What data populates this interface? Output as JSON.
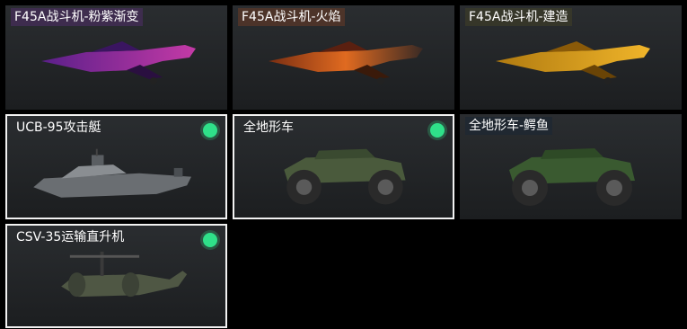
{
  "items": [
    {
      "label": "F45A战斗机-粉紫渐变",
      "icon": "jet-icon",
      "selected": false,
      "unlocked": false,
      "colors": [
        "#5a1f8a",
        "#c43aa6"
      ]
    },
    {
      "label": "F45A战斗机-火焰",
      "icon": "jet-icon",
      "selected": false,
      "unlocked": false,
      "colors": [
        "#7a2e12",
        "#e06a20"
      ]
    },
    {
      "label": "F45A战斗机-建造",
      "icon": "jet-icon",
      "selected": false,
      "unlocked": false,
      "colors": [
        "#b07a10",
        "#f0b52a"
      ]
    },
    {
      "label": "UCB-95攻击艇",
      "icon": "boat-icon",
      "selected": true,
      "unlocked": true,
      "colors": [
        "#6a6e72",
        "#a9adb0"
      ]
    },
    {
      "label": "全地形车",
      "icon": "atv-icon",
      "selected": true,
      "unlocked": true,
      "colors": [
        "#4a5a3c",
        "#7a8a66"
      ]
    },
    {
      "label": "全地形车-鳄鱼",
      "icon": "atv-icon",
      "selected": false,
      "unlocked": false,
      "colors": [
        "#3a5a30",
        "#6a8a4a"
      ]
    },
    {
      "label": "CSV-35运输直升机",
      "icon": "helicopter-icon",
      "selected": true,
      "unlocked": true,
      "colors": [
        "#4f5744",
        "#8a9176"
      ]
    }
  ],
  "colors": {
    "unlocked_dot": "#2fe089",
    "selected_border": "#f2f2f2"
  }
}
